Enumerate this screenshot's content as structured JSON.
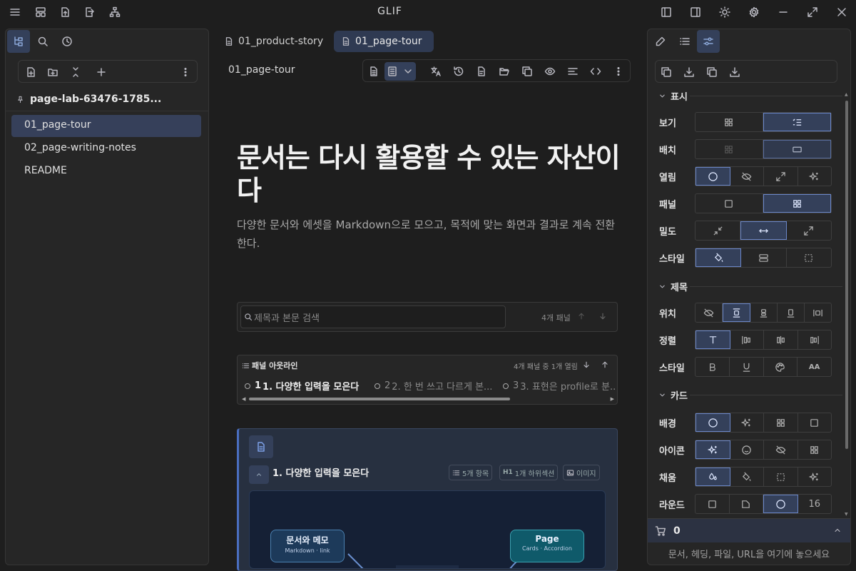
{
  "app": {
    "title": "GLIF"
  },
  "titlebar": {
    "left_icons": [
      "menu-icon",
      "layout-icon",
      "file-upload-icon",
      "file-export-icon",
      "sitemap-icon"
    ],
    "right_icons": [
      "sidebar-left-icon",
      "sidebar-right-icon",
      "sun-icon",
      "gear-icon",
      "minimize-icon",
      "maximize-icon",
      "close-icon"
    ]
  },
  "left": {
    "vault": "page-lab-63476-1785...",
    "files": [
      {
        "label": "01_page-tour",
        "active": true
      },
      {
        "label": "02_page-writing-notes",
        "active": false
      },
      {
        "label": "README",
        "active": false
      }
    ]
  },
  "tabs": [
    {
      "label": "01_product-story",
      "active": false
    },
    {
      "label": "01_page-tour",
      "active": true
    }
  ],
  "doc": {
    "title": "01_page-tour",
    "heading": "문서는 다시 활용할 수 있는 자산이다",
    "description": "다양한 문서와 에셋을 Markdown으로 모으고, 목적에 맞는 화면과 결과로 계속 전환한다.",
    "search_placeholder": "제목과 본문 검색",
    "panel_count": "4개 패널",
    "outline": {
      "title": "패널 아웃라인",
      "meta": "4개 패널 중 1개 열림",
      "items": [
        {
          "num": "1",
          "label": "1. 다양한 입력을 모은다",
          "active": true
        },
        {
          "num": "2",
          "label": "2. 한 번 쓰고 다르게 본...",
          "active": false
        },
        {
          "num": "3",
          "label": "3. 표현은 profile로 분...",
          "active": false
        }
      ]
    },
    "card": {
      "title": "1. 다양한 입력을 모은다",
      "chips": [
        "5개 항목",
        "1개 하위섹션",
        "이미지"
      ],
      "chip_h": "H1",
      "nodes": [
        {
          "title": "문서와 메모",
          "sub": "Markdown · link"
        },
        {
          "title": "Page",
          "sub": "Cards · Accordion"
        }
      ]
    }
  },
  "right": {
    "sections": {
      "display": "표시",
      "heading": "제목",
      "card": "카드"
    },
    "rows": {
      "view": "보기",
      "layout": "배치",
      "open": "열림",
      "panel": "패널",
      "density": "밀도",
      "style1": "스타일",
      "position": "위치",
      "align": "정렬",
      "style2": "스타일",
      "bg": "배경",
      "icon": "아이콘",
      "fill": "채움",
      "round": "라운드"
    },
    "round_value": "16",
    "aa_label": "AA",
    "cart_count": "0",
    "drop_hint": "문서, 헤딩, 파일, URL을 여기에 놓으세요"
  },
  "colors": {
    "accent": "#34405a",
    "accent_border": "#6a86c8",
    "background": "#1e1e1e"
  }
}
